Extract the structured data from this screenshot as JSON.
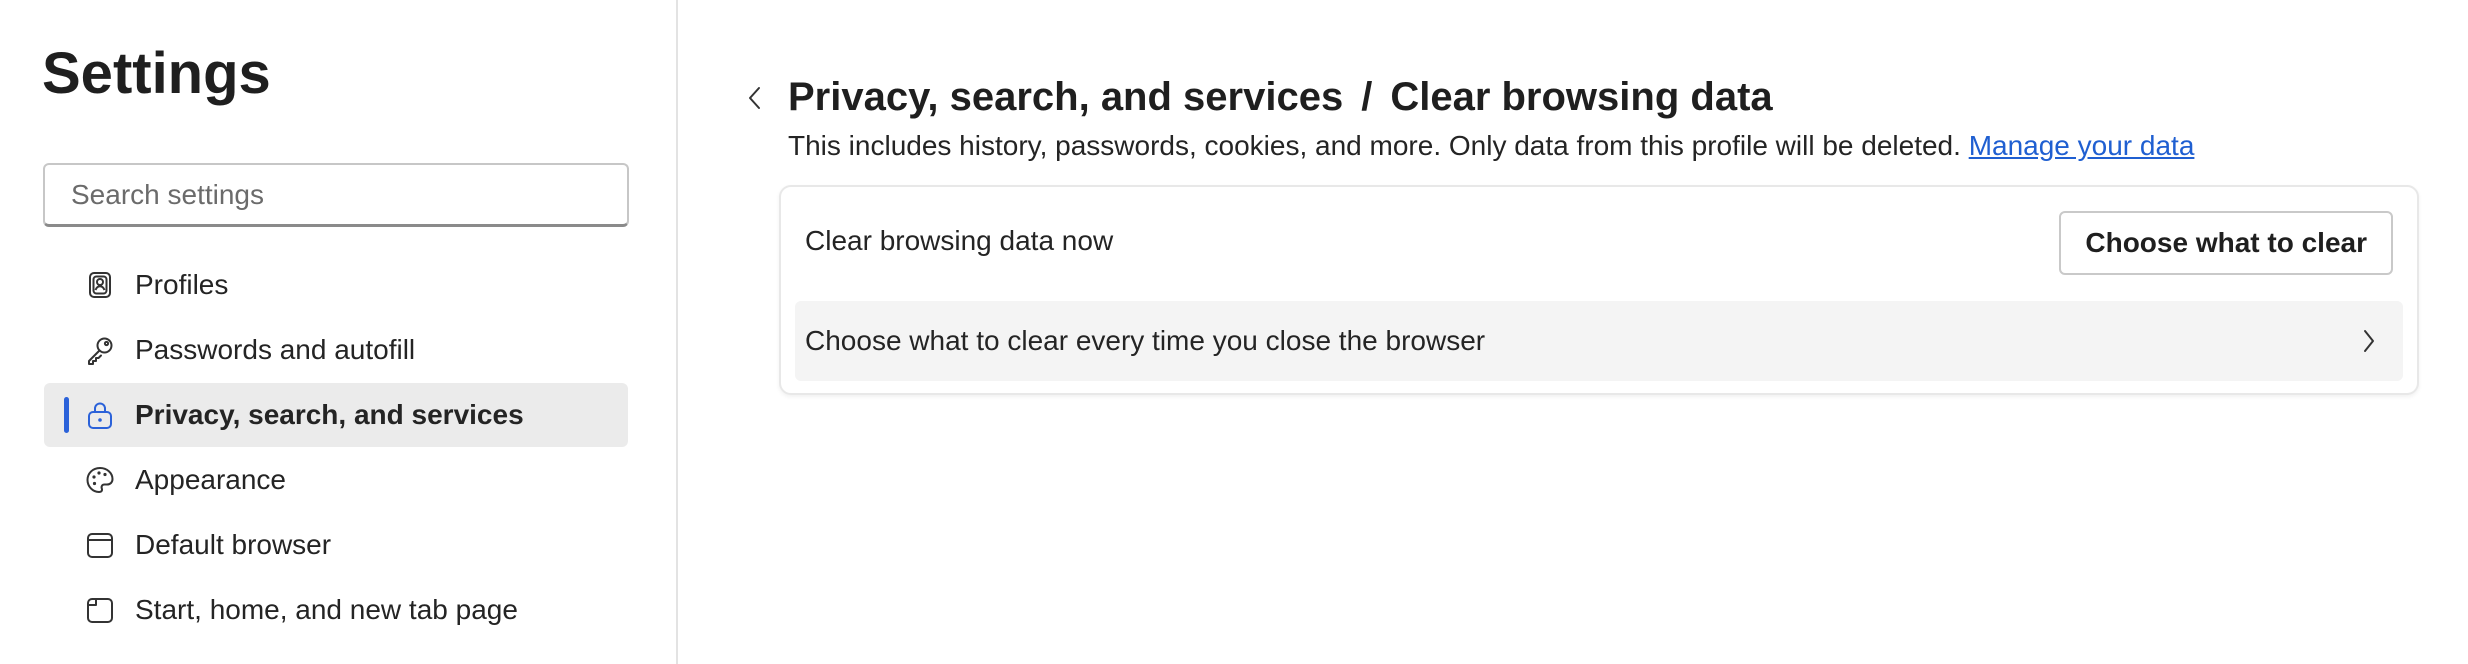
{
  "sidebar": {
    "title": "Settings",
    "search": {
      "placeholder": "Search settings",
      "value": ""
    },
    "items": [
      {
        "label": "Profiles",
        "icon": "profile-icon",
        "active": false
      },
      {
        "label": "Passwords and autofill",
        "icon": "key-icon",
        "active": false
      },
      {
        "label": "Privacy, search, and services",
        "icon": "lock-icon",
        "active": true
      },
      {
        "label": "Appearance",
        "icon": "palette-icon",
        "active": false
      },
      {
        "label": "Default browser",
        "icon": "browser-window-icon",
        "active": false
      },
      {
        "label": "Start, home, and new tab page",
        "icon": "home-tab-icon",
        "active": false
      }
    ]
  },
  "main": {
    "breadcrumb": {
      "parent": "Privacy, search, and services",
      "separator": "/",
      "current": "Clear browsing data"
    },
    "description": {
      "text": "This includes history, passwords, cookies, and more. Only data from this profile will be deleted.",
      "link": "Manage your data"
    },
    "card": {
      "clear_now_label": "Clear browsing data now",
      "choose_button": "Choose what to clear",
      "on_close_label": "Choose what to clear every time you close the browser"
    }
  },
  "colors": {
    "accent": "#2b62d9",
    "link": "#1f5fd1",
    "active_item_bg": "#ebebeb",
    "row_bg": "#f4f4f4"
  }
}
